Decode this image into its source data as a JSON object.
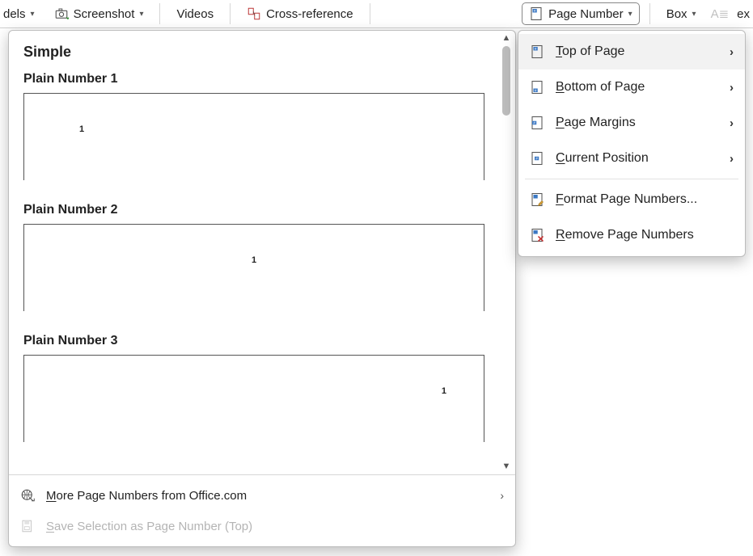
{
  "ribbon": {
    "models_partial": "dels",
    "screenshot": "Screenshot",
    "videos": "Videos",
    "cross_reference": "Cross-reference",
    "page_number": "Page Number",
    "box": "Box",
    "right_partial": "ex"
  },
  "gallery": {
    "section": "Simple",
    "items": [
      {
        "title": "Plain Number 1",
        "value": "1",
        "align": "left"
      },
      {
        "title": "Plain Number 2",
        "value": "1",
        "align": "center"
      },
      {
        "title": "Plain Number 3",
        "value": "1",
        "align": "right"
      }
    ],
    "footer_more_pre": "M",
    "footer_more_post": "ore Page Numbers from Office.com",
    "footer_save_pre": "S",
    "footer_save_post": "ave Selection as Page Number (Top)"
  },
  "menu": {
    "top_pre": "T",
    "top_post": "op of Page",
    "bottom_pre": "B",
    "bottom_post": "ottom of Page",
    "margins_pre": "P",
    "margins_post": "age Margins",
    "current_pre": "C",
    "current_post": "urrent Position",
    "format_pre": "F",
    "format_post": "ormat Page Numbers...",
    "remove_pre": "R",
    "remove_post": "emove Page Numbers"
  }
}
